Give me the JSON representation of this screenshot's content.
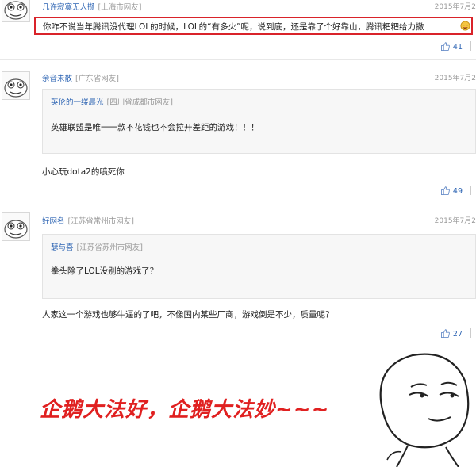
{
  "comments": [
    {
      "username": "几许寂寞无人撷",
      "location": "[上海市网友]",
      "date": "2015年7月2",
      "text": "你咋不说当年腾讯没代理LOL的时候，LOL的“有多火”呢，说到底，还是靠了个好靠山，腾讯粑粑给力撒",
      "likes": "41"
    },
    {
      "username": "余音未散",
      "location": "[广东省网友]",
      "date": "2015年7月2",
      "quote": {
        "username": "英伦的一缕晨光",
        "location": "[四川省成都市网友]",
        "text": "英雄联盟是唯一一款不花钱也不会拉开差距的游戏！！！"
      },
      "text": "小心玩dota2的喷死你",
      "likes": "49"
    },
    {
      "username": "好网名",
      "location": "[江苏省常州市网友]",
      "date": "2015年7月2",
      "quote": {
        "username": "瑟与喜",
        "location": "[江苏省苏州市网友]",
        "text": "拳头除了LOL没别的游戏了？"
      },
      "text": "人家这一个游戏也够牛逼的了吧，不像国内某些厂商，游戏倒是不少，质量呢？",
      "likes": "27"
    }
  ],
  "caption": "企鹅大法好，企鹅大法妙~~~",
  "colors": {
    "highlight_border": "#d9232a",
    "caption": "#e02020",
    "link": "#2d64b3"
  },
  "icons": [
    "avatar-face-icon",
    "thumbs-up-icon",
    "meme-face-icon"
  ]
}
